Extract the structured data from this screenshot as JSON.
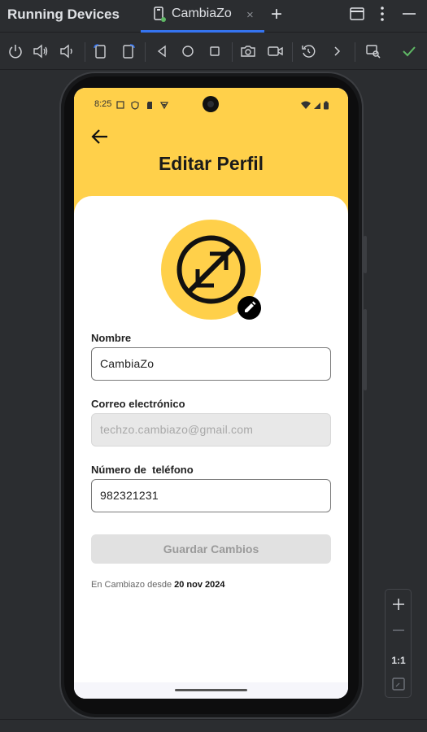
{
  "ide": {
    "title": "Running Devices",
    "tab_label": "CambiaZo",
    "tab_close": "×",
    "add_tab": "+"
  },
  "zoom": {
    "fit_label": "1:1"
  },
  "status_bar": {
    "time": "8:25"
  },
  "screen": {
    "title": "Editar Perfil",
    "fields": {
      "name_label": "Nombre",
      "name_value": "CambiaZo",
      "email_label": "Correo electrónico",
      "email_value": "techzo.cambiazo@gmail.com",
      "phone_label": "Número de  teléfono",
      "phone_value": "982321231"
    },
    "save_button": "Guardar Cambios",
    "member_since_prefix": "En Cambiazo desde",
    "member_since_date": "20 nov 2024"
  },
  "colors": {
    "brand_yellow": "#ffd04a",
    "accent_blue": "#3574f0",
    "check_green": "#5fb865"
  }
}
